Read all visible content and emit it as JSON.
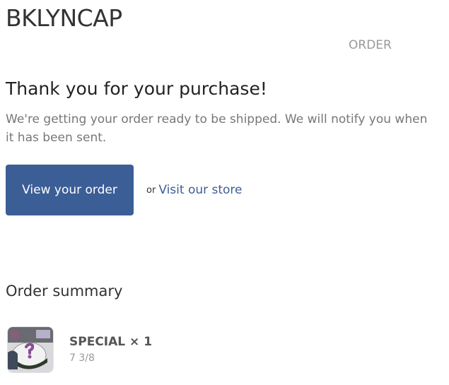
{
  "header": {
    "shop_name": "BKLYNCAP",
    "order_label": "ORDER"
  },
  "confirmation": {
    "title": "Thank you for your purchase!",
    "message": "We're getting your order ready to be shipped. We will notify you when it has been sent.",
    "view_order_label": "View your order",
    "or_text": "or",
    "visit_store_label": "Visit our store",
    "accent_color": "#3c5e96"
  },
  "summary": {
    "title": "Order summary",
    "items": [
      {
        "title": "SPECIAL × 1",
        "variant": "7 3/8",
        "image_icon": "product-cap-thumbnail"
      }
    ]
  }
}
